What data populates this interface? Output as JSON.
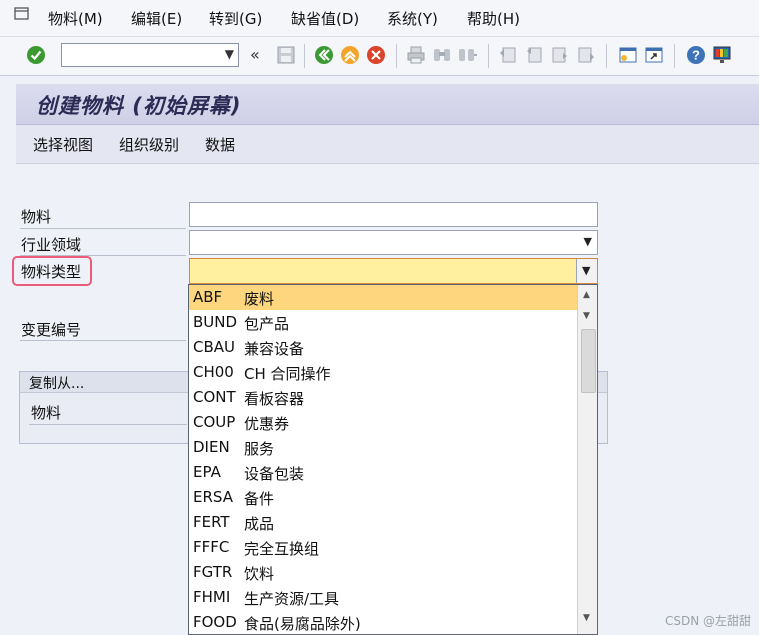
{
  "menu": [
    "物料(M)",
    "编辑(E)",
    "转到(G)",
    "缺省值(D)",
    "系统(Y)",
    "帮助(H)"
  ],
  "title": "创建物料 (初始屏幕)",
  "app_toolbar": [
    "选择视图",
    "组织级别",
    "数据"
  ],
  "form": {
    "material_label": "物料",
    "industry_label": "行业领域",
    "material_type_label": "物料类型",
    "change_number_label": "变更编号",
    "copy_from_label": "复制从...",
    "copy_material_label": "物料"
  },
  "dropdown_options": [
    {
      "code": "ABF",
      "desc": "废料"
    },
    {
      "code": "BUND",
      "desc": "包产品"
    },
    {
      "code": "CBAU",
      "desc": "兼容设备"
    },
    {
      "code": "CH00",
      "desc": "CH 合同操作"
    },
    {
      "code": "CONT",
      "desc": "看板容器"
    },
    {
      "code": "COUP",
      "desc": "优惠券"
    },
    {
      "code": "DIEN",
      "desc": "服务"
    },
    {
      "code": "EPA",
      "desc": "设备包装"
    },
    {
      "code": "ERSA",
      "desc": "备件"
    },
    {
      "code": "FERT",
      "desc": "成品"
    },
    {
      "code": "FFFC",
      "desc": "完全互换组"
    },
    {
      "code": "FGTR",
      "desc": "饮料"
    },
    {
      "code": "FHMI",
      "desc": "生产资源/工具"
    },
    {
      "code": "FOOD",
      "desc": "食品(易腐品除外)"
    }
  ],
  "watermark": "CSDN @左甜甜",
  "colors": {
    "selected_option": "#fdd67e",
    "active_field": "#fff0a0",
    "highlight_border": "#ec5b78"
  }
}
